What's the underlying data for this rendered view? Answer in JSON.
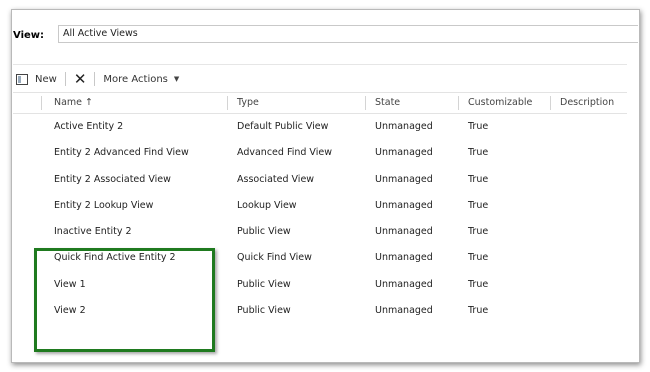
{
  "view_bar": {
    "label": "View:",
    "selected": "All Active Views"
  },
  "toolbar": {
    "new_label": "New",
    "more_actions_label": "More Actions"
  },
  "grid": {
    "columns": [
      {
        "label": "Name ↑"
      },
      {
        "label": "Type"
      },
      {
        "label": "State"
      },
      {
        "label": "Customizable"
      },
      {
        "label": "Description"
      }
    ],
    "rows": [
      {
        "name": "Active Entity 2",
        "type": "Default Public View",
        "state": "Unmanaged",
        "customizable": "True",
        "description": ""
      },
      {
        "name": "Entity 2 Advanced Find View",
        "type": "Advanced Find View",
        "state": "Unmanaged",
        "customizable": "True",
        "description": ""
      },
      {
        "name": "Entity 2 Associated View",
        "type": "Associated View",
        "state": "Unmanaged",
        "customizable": "True",
        "description": ""
      },
      {
        "name": "Entity 2 Lookup View",
        "type": "Lookup View",
        "state": "Unmanaged",
        "customizable": "True",
        "description": ""
      },
      {
        "name": "Inactive Entity 2",
        "type": "Public View",
        "state": "Unmanaged",
        "customizable": "True",
        "description": ""
      },
      {
        "name": "Quick Find Active Entity 2",
        "type": "Quick Find View",
        "state": "Unmanaged",
        "customizable": "True",
        "description": ""
      },
      {
        "name": "View 1",
        "type": "Public View",
        "state": "Unmanaged",
        "customizable": "True",
        "description": ""
      },
      {
        "name": "View 2",
        "type": "Public View",
        "state": "Unmanaged",
        "customizable": "True",
        "description": ""
      }
    ]
  },
  "highlight_color": "#1f7a1f"
}
